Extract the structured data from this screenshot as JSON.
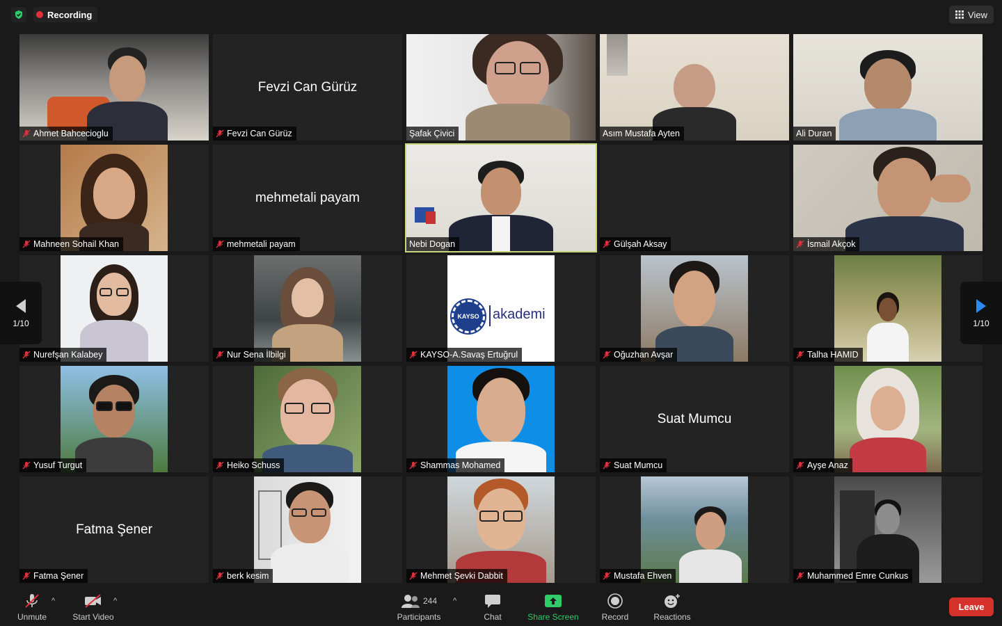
{
  "top_bar": {
    "recording_label": "Recording",
    "view_label": "View"
  },
  "pager": {
    "left_label": "1/10",
    "right_label": "1/10"
  },
  "participants": [
    {
      "name": "Ahmet Bahcecioglu",
      "muted": true,
      "video": true
    },
    {
      "name": "Fevzi Can Gürüz",
      "muted": true,
      "video": false,
      "display_name": "Fevzi Can Gürüz"
    },
    {
      "name": "Şafak Çivici",
      "muted": false,
      "video": true
    },
    {
      "name": "Asım Mustafa Ayten",
      "muted": false,
      "video": true
    },
    {
      "name": "Ali Duran",
      "muted": false,
      "video": true
    },
    {
      "name": "Mahneen Sohail Khan",
      "muted": true,
      "video": true
    },
    {
      "name": "mehmetali payam",
      "muted": true,
      "video": false,
      "display_name": "mehmetali payam"
    },
    {
      "name": "Nebi Dogan",
      "muted": false,
      "video": true,
      "active_speaker": true
    },
    {
      "name": "Gülşah Aksay",
      "muted": true,
      "video": false,
      "display_name": ""
    },
    {
      "name": "İsmail Akçok",
      "muted": true,
      "video": true
    },
    {
      "name": "Nurefşan Kalabey",
      "muted": true,
      "video": true
    },
    {
      "name": "Nur Sena İlbilgi",
      "muted": true,
      "video": true
    },
    {
      "name": "KAYSO-A.Savaş Ertuğrul",
      "muted": true,
      "video": true,
      "logo_text": "akademi",
      "logo_badge": "KAYSO"
    },
    {
      "name": "Oğuzhan Avşar",
      "muted": true,
      "video": true
    },
    {
      "name": "Talha HAMID",
      "muted": true,
      "video": true
    },
    {
      "name": "Yusuf Turgut",
      "muted": true,
      "video": true
    },
    {
      "name": "Heiko Schuss",
      "muted": true,
      "video": true
    },
    {
      "name": "Shammas Mohamed",
      "muted": true,
      "video": true
    },
    {
      "name": "Suat Mumcu",
      "muted": true,
      "video": false,
      "display_name": "Suat Mumcu"
    },
    {
      "name": "Ayşe Anaz",
      "muted": true,
      "video": true
    },
    {
      "name": "Fatma Şener",
      "muted": true,
      "video": false,
      "display_name": "Fatma Şener"
    },
    {
      "name": "berk kesim",
      "muted": true,
      "video": true
    },
    {
      "name": "Mehmet Şevki Dabbit",
      "muted": true,
      "video": true
    },
    {
      "name": "Mustafa Ehven",
      "muted": true,
      "video": true
    },
    {
      "name": "Muhammed Emre Cunkus",
      "muted": true,
      "video": true
    }
  ],
  "toolbar": {
    "unmute_label": "Unmute",
    "start_video_label": "Start Video",
    "participants_label": "Participants",
    "participants_count": "244",
    "chat_label": "Chat",
    "share_screen_label": "Share Screen",
    "record_label": "Record",
    "reactions_label": "Reactions",
    "leave_label": "Leave"
  },
  "colors": {
    "background": "#1a1a1a",
    "tile": "#232323",
    "active_speaker_border": "#c7d67a",
    "recording_dot": "#e0313c",
    "share_green": "#2fcd6a",
    "leave_red": "#d6322b",
    "muted_icon": "#e0313c"
  }
}
